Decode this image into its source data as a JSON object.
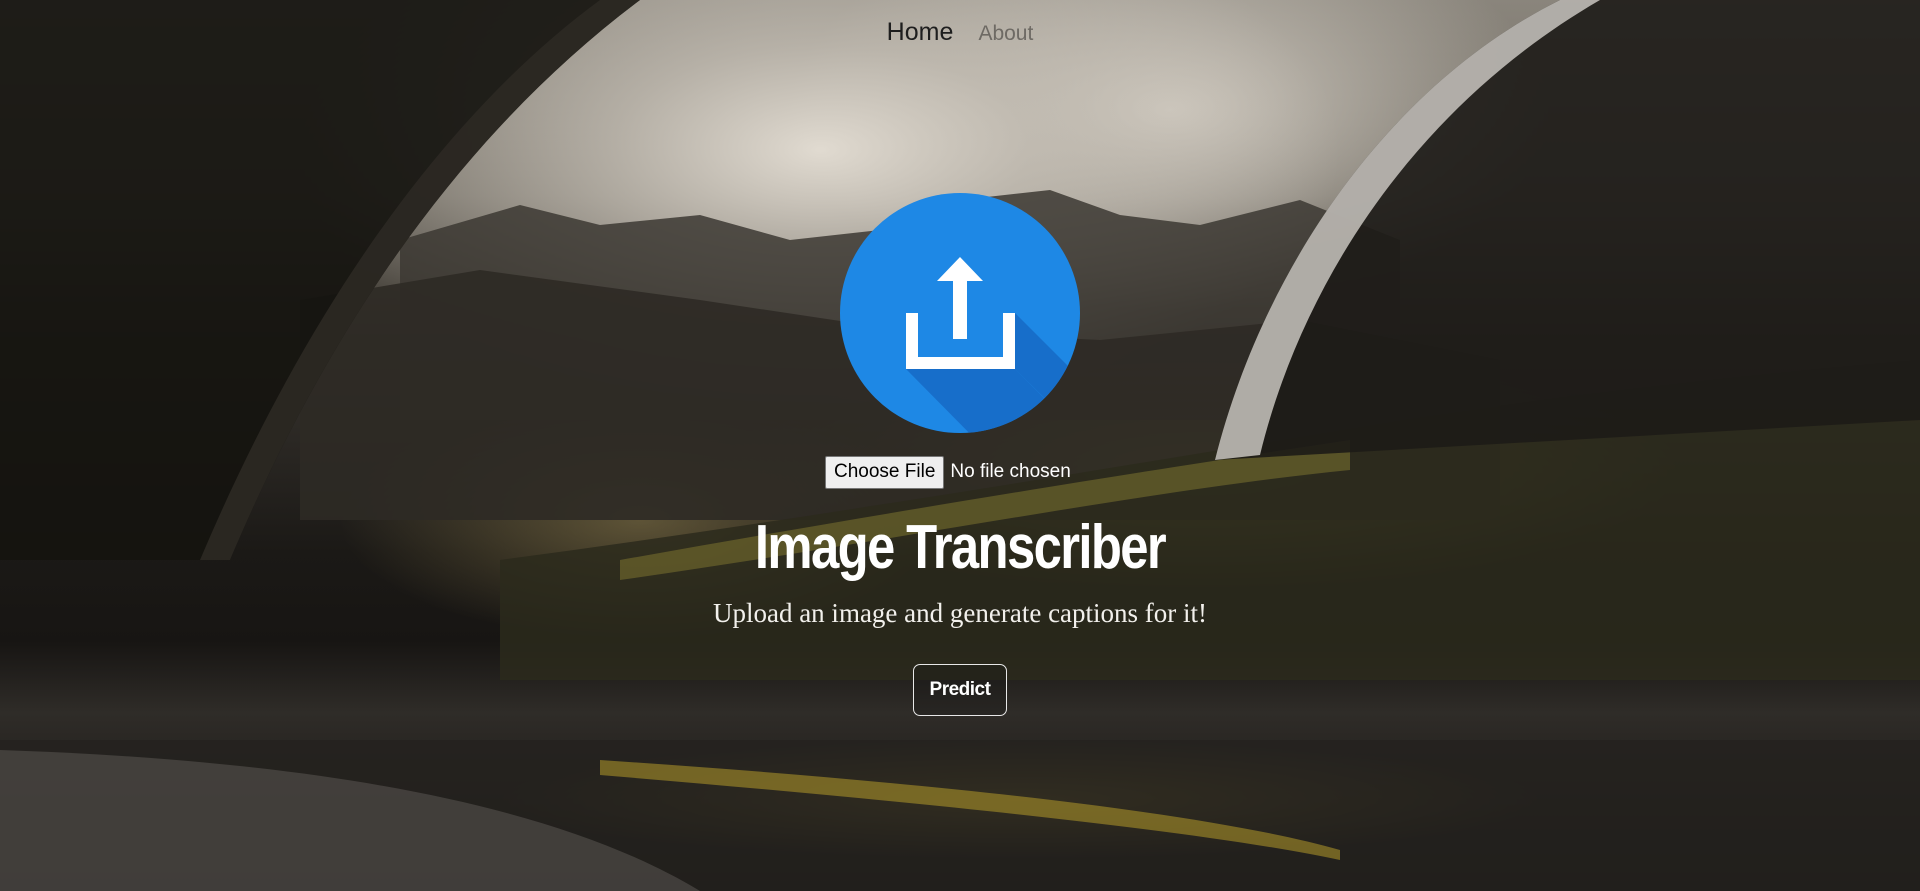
{
  "nav": {
    "home_label": "Home",
    "about_label": "About"
  },
  "upload": {
    "icon": "upload-icon",
    "icon_color": "#1E88E5",
    "choose_button_label": "Choose File",
    "status_text": "No file chosen"
  },
  "hero": {
    "title": "Image Transcriber",
    "subtitle": "Upload an image and generate captions for it!",
    "predict_label": "Predict"
  }
}
